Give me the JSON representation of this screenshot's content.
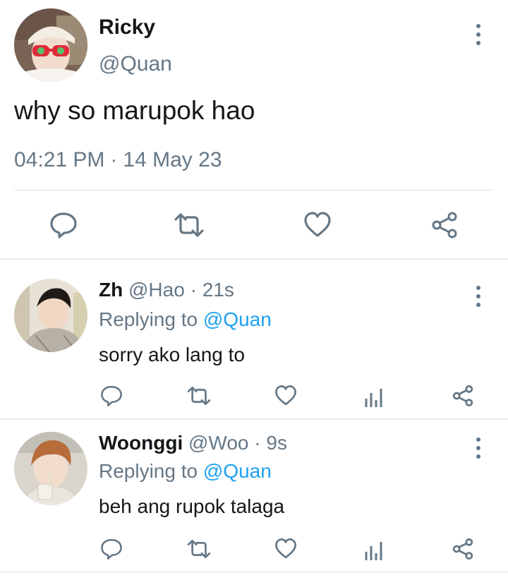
{
  "main_tweet": {
    "name": "Ricky",
    "handle": "@Quan",
    "text": "why so marupok hao",
    "time": "04:21 PM",
    "separator": "·",
    "date": "14 May 23",
    "avatar_icon": "user-photo-ricky",
    "actions": [
      "reply-icon",
      "retweet-icon",
      "like-icon",
      "share-icon"
    ]
  },
  "replies": [
    {
      "name": "Zh",
      "handle": "@Hao",
      "separator": "·",
      "time": "21s",
      "replying_prefix": "Replying to",
      "replying_to": "@Quan",
      "text": "sorry ako lang to",
      "avatar_icon": "user-photo-zh"
    },
    {
      "name": "Woonggi",
      "handle": "@Woo",
      "separator": "·",
      "time": "9s",
      "replying_prefix": "Replying to",
      "replying_to": "@Quan",
      "text": "beh ang rupok talaga",
      "avatar_icon": "user-photo-woonggi"
    }
  ],
  "colors": {
    "text": "#14171a",
    "secondary": "#657786",
    "link": "#1da1f2",
    "divider": "#e6ecf0"
  }
}
